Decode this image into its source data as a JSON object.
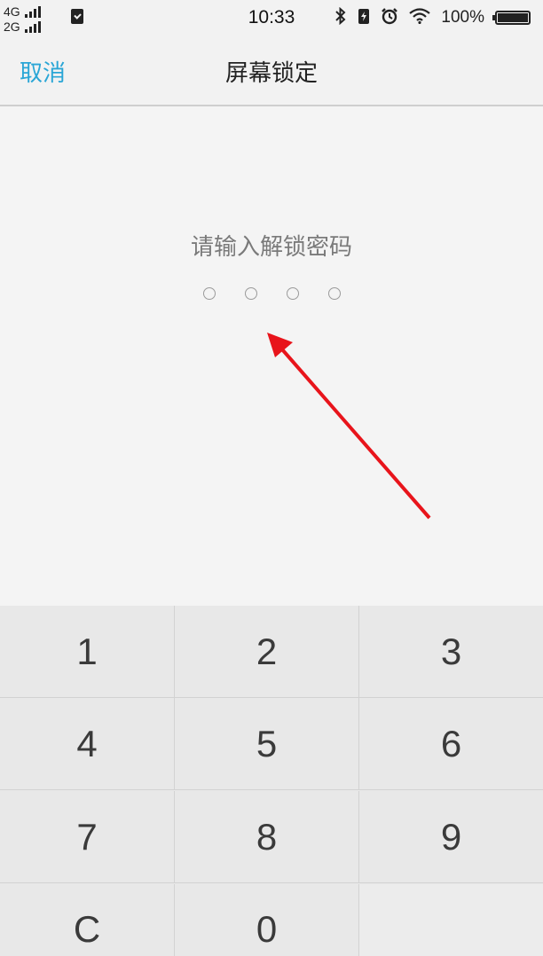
{
  "status_bar": {
    "net1": "4G",
    "net2": "2G",
    "time": "10:33",
    "battery": "100%",
    "icons": [
      "bluetooth-icon",
      "charging-icon",
      "alarm-icon",
      "wifi-icon",
      "battery-icon"
    ]
  },
  "nav": {
    "cancel": "取消",
    "title": "屏幕锁定"
  },
  "prompt": "请输入解锁密码",
  "pin_length": 4,
  "keypad": {
    "k1": "1",
    "k2": "2",
    "k3": "3",
    "k4": "4",
    "k5": "5",
    "k6": "6",
    "k7": "7",
    "k8": "8",
    "k9": "9",
    "kc": "C",
    "k0": "0"
  },
  "colors": {
    "accent": "#2aa6d6",
    "annotation_arrow": "#e8141b"
  }
}
